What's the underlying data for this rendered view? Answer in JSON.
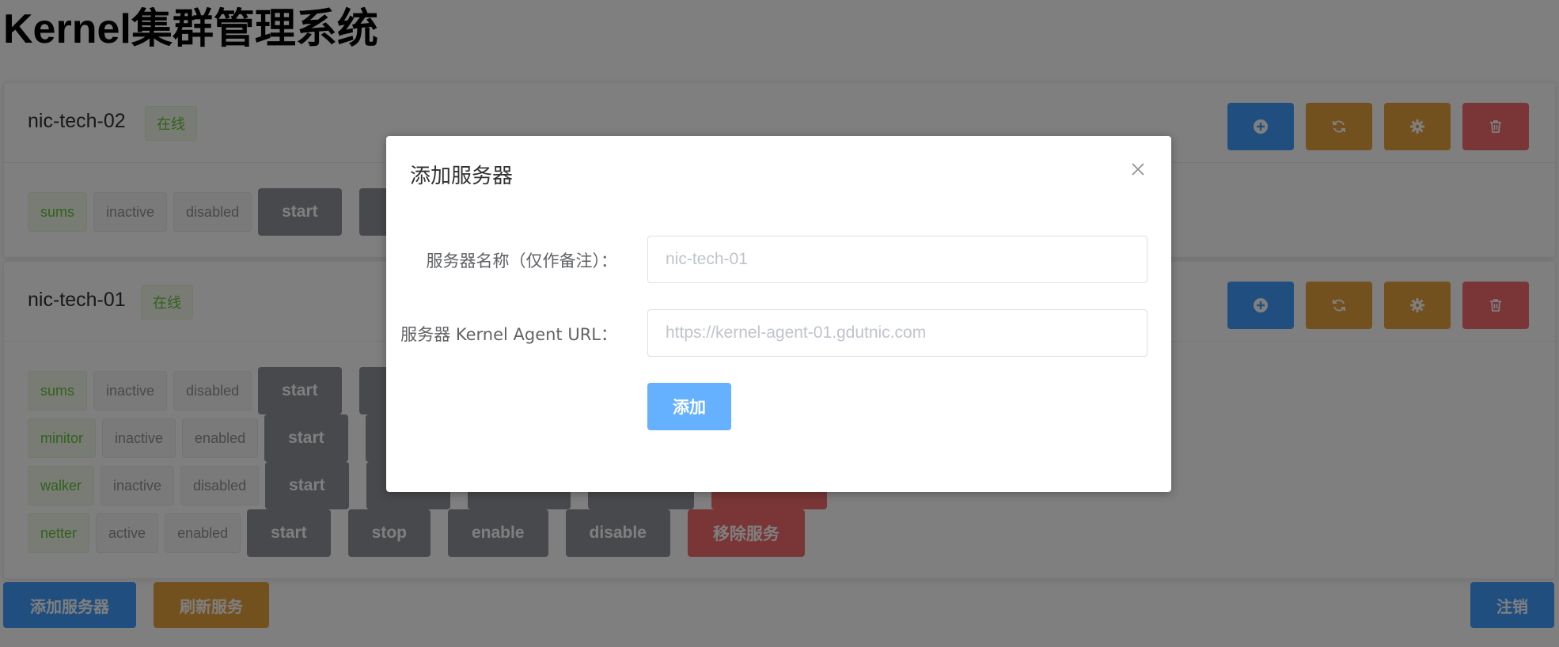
{
  "app": {
    "title": "Kernel集群管理系统"
  },
  "colors": {
    "primary": "#409eff",
    "warning": "#e6a23c",
    "danger": "#f56c6c",
    "info": "#909399",
    "success": "#67c23a"
  },
  "servers": [
    {
      "name": "nic-tech-02",
      "status": "在线",
      "actions": [
        "plus-circle-icon",
        "refresh-icon",
        "gear-icon",
        "trash-icon"
      ],
      "services": [
        {
          "name": "sums",
          "state": "inactive",
          "enabled": "disabled",
          "buttons": {
            "start": "start"
          }
        }
      ]
    },
    {
      "name": "nic-tech-01",
      "status": "在线",
      "actions": [
        "plus-circle-icon",
        "refresh-icon",
        "gear-icon",
        "trash-icon"
      ],
      "services": [
        {
          "name": "sums",
          "state": "inactive",
          "enabled": "disabled",
          "buttons": {
            "start": "start"
          }
        },
        {
          "name": "minitor",
          "state": "inactive",
          "enabled": "enabled",
          "buttons": {
            "start": "start"
          }
        },
        {
          "name": "walker",
          "state": "inactive",
          "enabled": "disabled",
          "buttons": {
            "start": "start"
          }
        },
        {
          "name": "netter",
          "state": "active",
          "enabled": "enabled",
          "buttons": {
            "start": "start",
            "stop": "stop",
            "enable": "enable",
            "disable": "disable",
            "remove": "移除服务"
          }
        }
      ]
    }
  ],
  "footer": {
    "add_server": "添加服务器",
    "refresh_services": "刷新服务",
    "logout": "注销"
  },
  "dialog": {
    "title": "添加服务器",
    "close_icon": "close-icon",
    "fields": [
      {
        "label": "服务器名称（仅作备注）：",
        "placeholder": "nic-tech-01",
        "value": ""
      },
      {
        "label": "服务器 Kernel Agent URL：",
        "placeholder": "https://kernel-agent-01.gdutnic.com",
        "value": ""
      }
    ],
    "submit": "添加"
  }
}
